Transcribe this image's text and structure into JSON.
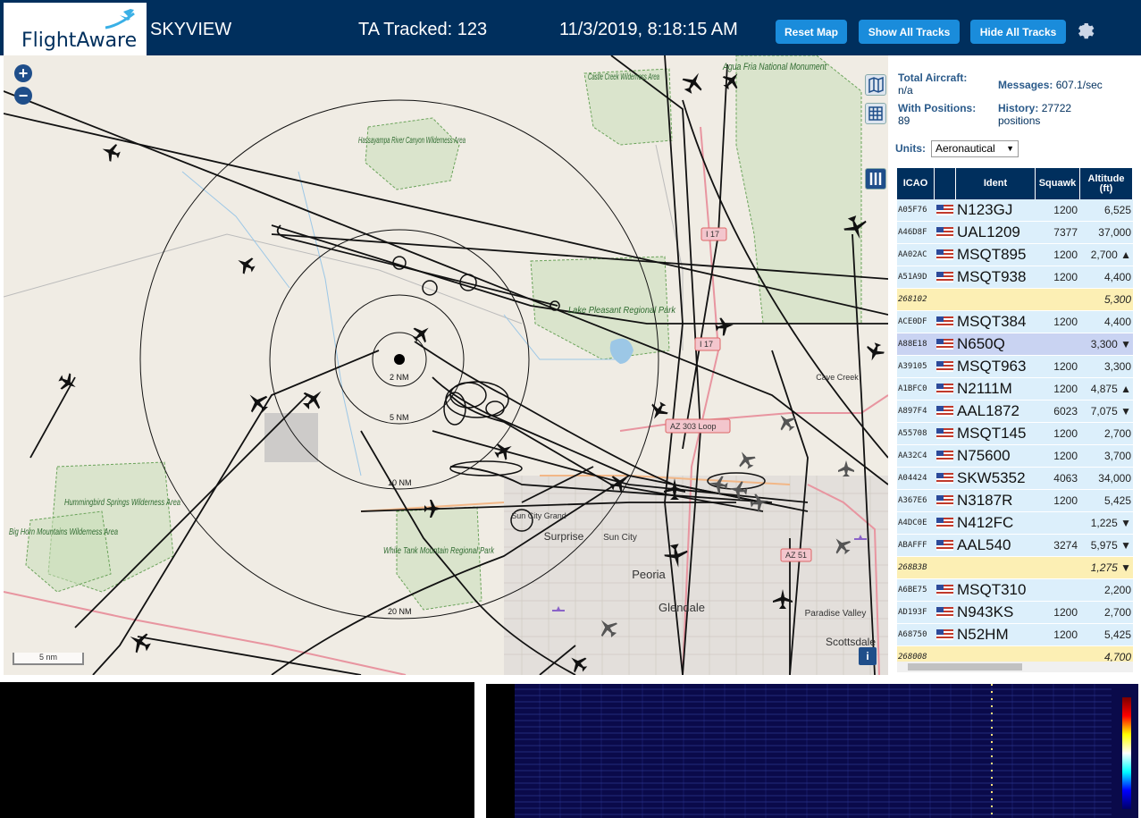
{
  "header": {
    "logo_text": "FlightAware",
    "app_title": "SKYVIEW",
    "ta_tracked": "TA Tracked: 123",
    "datetime": "11/3/2019, 8:18:15 AM",
    "buttons": {
      "reset": "Reset Map",
      "show": "Show All Tracks",
      "hide": "Hide All Tracks"
    },
    "brand_color": "#002f5d",
    "button_color": "#1a8cdb"
  },
  "map": {
    "zoom_in": "+",
    "zoom_out": "−",
    "scale": "5 nm",
    "info": "i",
    "range_rings": [
      "2 NM",
      "5 NM",
      "10 NM",
      "20 NM"
    ],
    "places": {
      "castle_creek": "Castle Creek Wilderness Area",
      "hassayampa": "Hassayampa River Canyon Wilderness Area",
      "agua_fria": "Agua Fria National Monument",
      "lake_pleasant": "Lake Pleasant Regional Park",
      "cave_creek": "Cave Creek",
      "hummingbird": "Hummingbird Springs Wilderness Area",
      "big_horn": "Big Horn Mountains Wilderness Area",
      "white_tank": "White Tank Mountain Regional Park",
      "sun_city_grand": "Sun City Grand",
      "surprise": "Surprise",
      "sun_city": "Sun City",
      "peoria": "Peoria",
      "glendale": "Glendale",
      "paradise_valley": "Paradise Valley",
      "scottsdale": "Scottsdale"
    },
    "shields": {
      "i17_a": "I 17",
      "i17_b": "I 17",
      "az303": "AZ 303 Loop",
      "az51": "AZ 51"
    }
  },
  "sidebar": {
    "total_aircraft_label": "Total Aircraft:",
    "total_aircraft_value": "n/a",
    "with_positions_label": "With Positions:",
    "with_positions_value": "89",
    "messages_label": "Messages:",
    "messages_value": "607.1/sec",
    "history_label": "History:",
    "history_value": "27722 positions",
    "units_label": "Units:",
    "units_value": "Aeronautical",
    "columns": {
      "icao": "ICAO",
      "ident": "Ident",
      "squawk": "Squawk",
      "altitude": "Altitude (ft)"
    },
    "rows": [
      {
        "icao": "A05F76",
        "flag": true,
        "ident": "N123GJ",
        "squawk": "1200",
        "alt": "6,525",
        "style": ""
      },
      {
        "icao": "A46D8F",
        "flag": true,
        "ident": "UAL1209",
        "squawk": "7377",
        "alt": "37,000",
        "style": ""
      },
      {
        "icao": "AA02AC",
        "flag": true,
        "ident": "MSQT895",
        "squawk": "1200",
        "alt": "2,700 ▲",
        "style": ""
      },
      {
        "icao": "A51A9D",
        "flag": true,
        "ident": "MSQT938",
        "squawk": "1200",
        "alt": "4,400",
        "style": ""
      },
      {
        "icao": "268102",
        "flag": false,
        "ident": "",
        "squawk": "",
        "alt": "5,300",
        "style": "yellow"
      },
      {
        "icao": "ACE0DF",
        "flag": true,
        "ident": "MSQT384",
        "squawk": "1200",
        "alt": "4,400",
        "style": ""
      },
      {
        "icao": "A88E18",
        "flag": true,
        "ident": "N650Q",
        "squawk": "",
        "alt": "3,300 ▼",
        "style": "sel"
      },
      {
        "icao": "A39105",
        "flag": true,
        "ident": "MSQT963",
        "squawk": "1200",
        "alt": "3,300",
        "style": ""
      },
      {
        "icao": "A1BFC0",
        "flag": true,
        "ident": "N2111M",
        "squawk": "1200",
        "alt": "4,875 ▲",
        "style": ""
      },
      {
        "icao": "A897F4",
        "flag": true,
        "ident": "AAL1872",
        "squawk": "6023",
        "alt": "7,075 ▼",
        "style": ""
      },
      {
        "icao": "A55708",
        "flag": true,
        "ident": "MSQT145",
        "squawk": "1200",
        "alt": "2,700",
        "style": ""
      },
      {
        "icao": "AA32C4",
        "flag": true,
        "ident": "N75600",
        "squawk": "1200",
        "alt": "3,700",
        "style": ""
      },
      {
        "icao": "A04424",
        "flag": true,
        "ident": "SKW5352",
        "squawk": "4063",
        "alt": "34,000",
        "style": ""
      },
      {
        "icao": "A367E6",
        "flag": true,
        "ident": "N3187R",
        "squawk": "1200",
        "alt": "5,425",
        "style": ""
      },
      {
        "icao": "A4DC0E",
        "flag": true,
        "ident": "N412FC",
        "squawk": "",
        "alt": "1,225 ▼",
        "style": ""
      },
      {
        "icao": "ABAFFF",
        "flag": true,
        "ident": "AAL540",
        "squawk": "3274",
        "alt": "5,975 ▼",
        "style": ""
      },
      {
        "icao": "268B3B",
        "flag": false,
        "ident": "",
        "squawk": "",
        "alt": "1,275 ▼",
        "style": "yellow"
      },
      {
        "icao": "A6BE75",
        "flag": true,
        "ident": "MSQT310",
        "squawk": "",
        "alt": "2,200",
        "style": ""
      },
      {
        "icao": "AD193F",
        "flag": true,
        "ident": "N943KS",
        "squawk": "1200",
        "alt": "2,700",
        "style": ""
      },
      {
        "icao": "A68750",
        "flag": true,
        "ident": "N52HM",
        "squawk": "1200",
        "alt": "5,425",
        "style": ""
      },
      {
        "icao": "268008",
        "flag": false,
        "ident": "",
        "squawk": "",
        "alt": "4,700",
        "style": "yellow"
      }
    ]
  }
}
